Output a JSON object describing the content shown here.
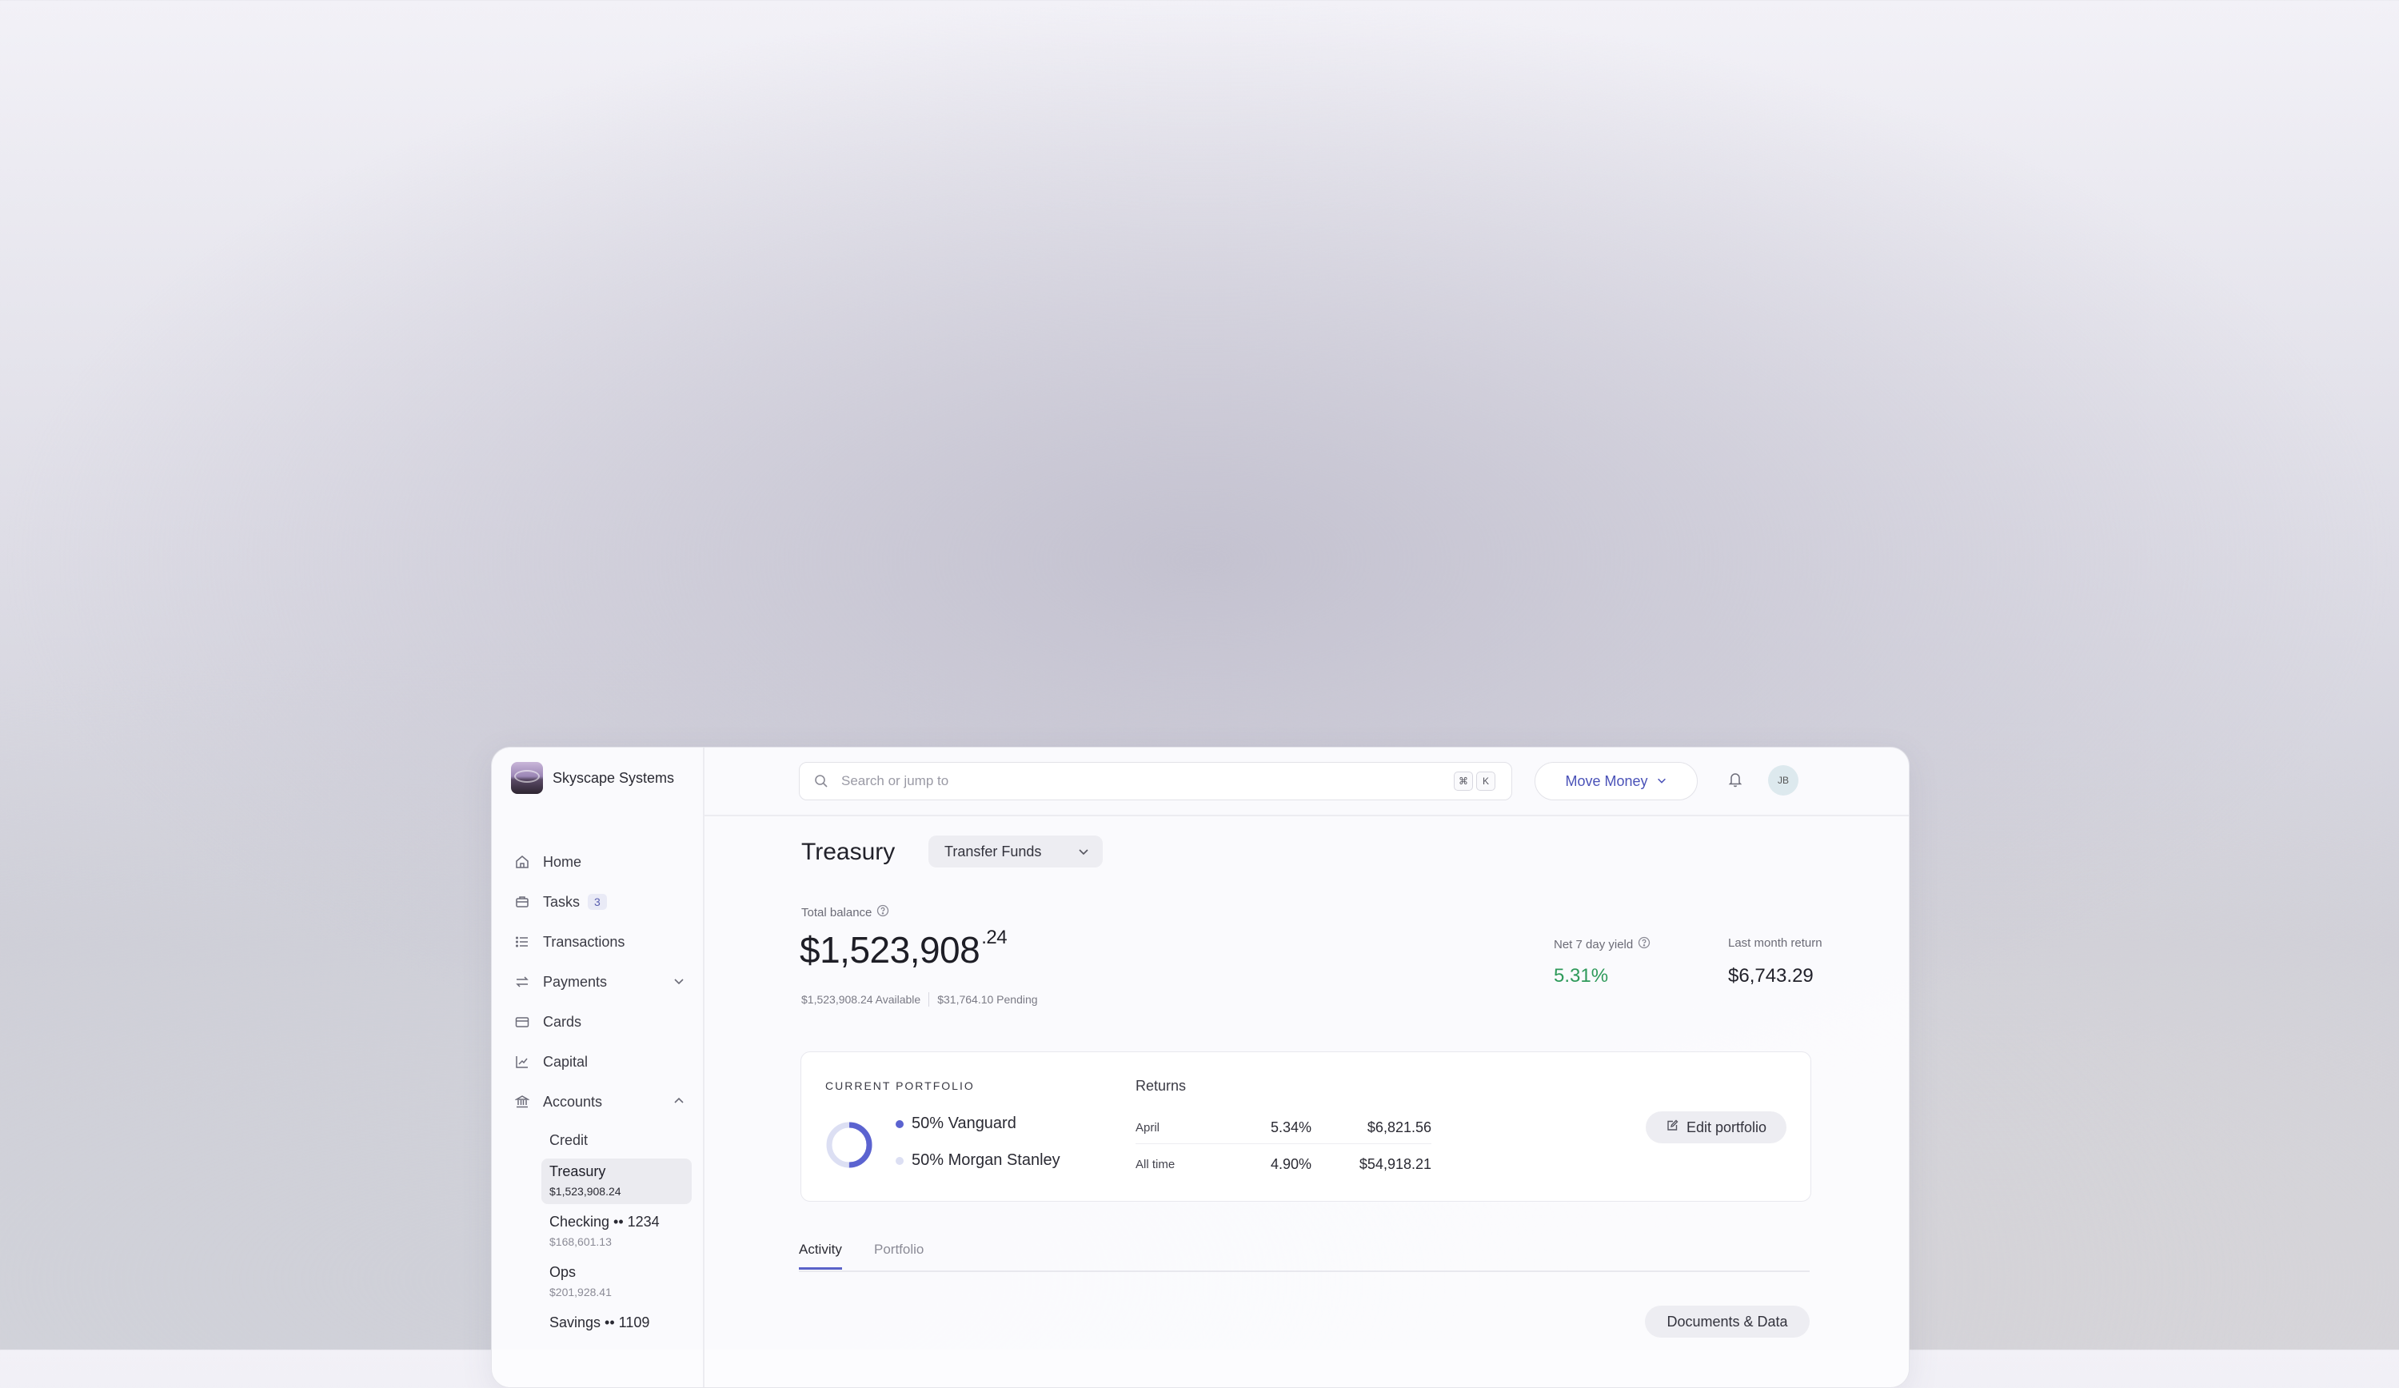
{
  "brand": {
    "name": "Skyscape Systems"
  },
  "sidebar": {
    "items": [
      {
        "label": "Home",
        "icon": "home-icon"
      },
      {
        "label": "Tasks",
        "icon": "tasks-icon",
        "badge": "3"
      },
      {
        "label": "Transactions",
        "icon": "list-icon"
      },
      {
        "label": "Payments",
        "icon": "arrows-icon",
        "expanded": false
      },
      {
        "label": "Cards",
        "icon": "card-icon"
      },
      {
        "label": "Capital",
        "icon": "chart-icon"
      },
      {
        "label": "Accounts",
        "icon": "bank-icon",
        "expanded": true
      }
    ],
    "accounts": [
      {
        "label": "Credit"
      },
      {
        "label": "Treasury",
        "balance": "$1,523,908.24",
        "active": true
      },
      {
        "label": "Checking •• 1234",
        "balance": "$168,601.13"
      },
      {
        "label": "Ops",
        "balance": "$201,928.41"
      },
      {
        "label": "Savings •• 1109"
      }
    ]
  },
  "topbar": {
    "search_placeholder": "Search or jump to",
    "shortcut_cmd": "⌘",
    "shortcut_key": "K",
    "move_money_label": "Move Money",
    "avatar_initials": "JB",
    "accent_color": "#4a52b8"
  },
  "page": {
    "title": "Treasury",
    "transfer_label": "Transfer Funds",
    "total_label": "Total balance",
    "total_main": "$1,523,908",
    "total_cents": ".24",
    "available": "$1,523,908.24 Available",
    "pending": "$31,764.10 Pending",
    "yield_label": "Net 7 day yield",
    "yield_value": "5.31%",
    "yield_color": "#2e9a5a",
    "return_label": "Last month return",
    "return_value": "$6,743.29"
  },
  "portfolio": {
    "label": "CURRENT PORTFOLIO",
    "holdings": [
      {
        "label": "50% Vanguard",
        "color": "#5b63d0"
      },
      {
        "label": "50% Morgan Stanley",
        "color": "#dcdff3"
      }
    ],
    "returns_label": "Returns",
    "returns": [
      {
        "period": "April",
        "pct": "5.34%",
        "amount": "$6,821.56"
      },
      {
        "period": "All time",
        "pct": "4.90%",
        "amount": "$54,918.21"
      }
    ],
    "edit_label": "Edit portfolio"
  },
  "tabs": [
    {
      "label": "Activity",
      "active": true
    },
    {
      "label": "Portfolio",
      "active": false
    }
  ],
  "docs_label": "Documents & Data"
}
